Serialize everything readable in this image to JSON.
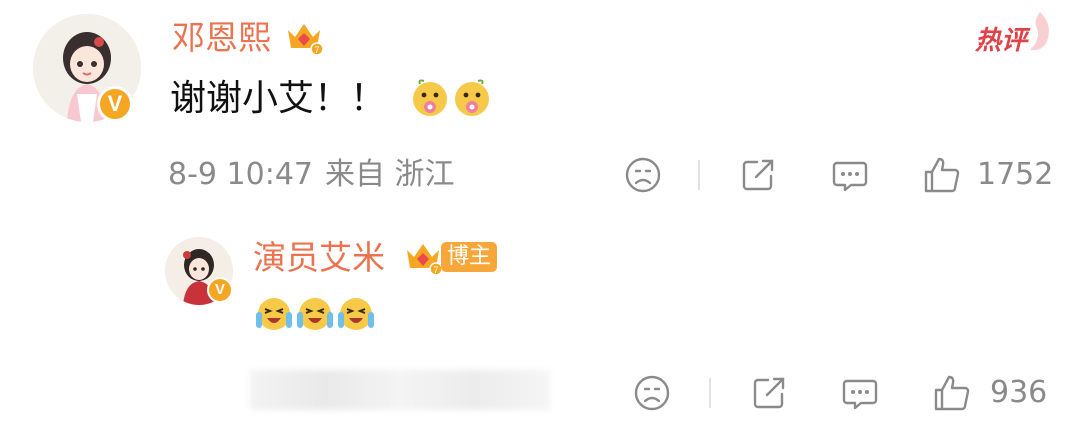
{
  "comment": {
    "username": "邓恩熙",
    "crown_level": "7",
    "text": "谢谢小艾！！",
    "emojis": [
      "hug-flower-emoji",
      "hug-flower-emoji"
    ],
    "hot_label": "热评",
    "time": "8-9 10:47",
    "source": "来自 浙江",
    "likes": "1752",
    "avatar_badge": "V"
  },
  "reply": {
    "username": "演员艾米",
    "crown_level": "7",
    "blogger_tag": "博主",
    "emojis": [
      "laugh-cry-emoji",
      "laugh-cry-emoji",
      "laugh-cry-emoji"
    ],
    "likes": "936",
    "avatar_badge": "V"
  },
  "colors": {
    "username": "#eb7350",
    "hot": "#e0424a",
    "badge": "#f5a623",
    "meta": "#8a8a8a"
  }
}
